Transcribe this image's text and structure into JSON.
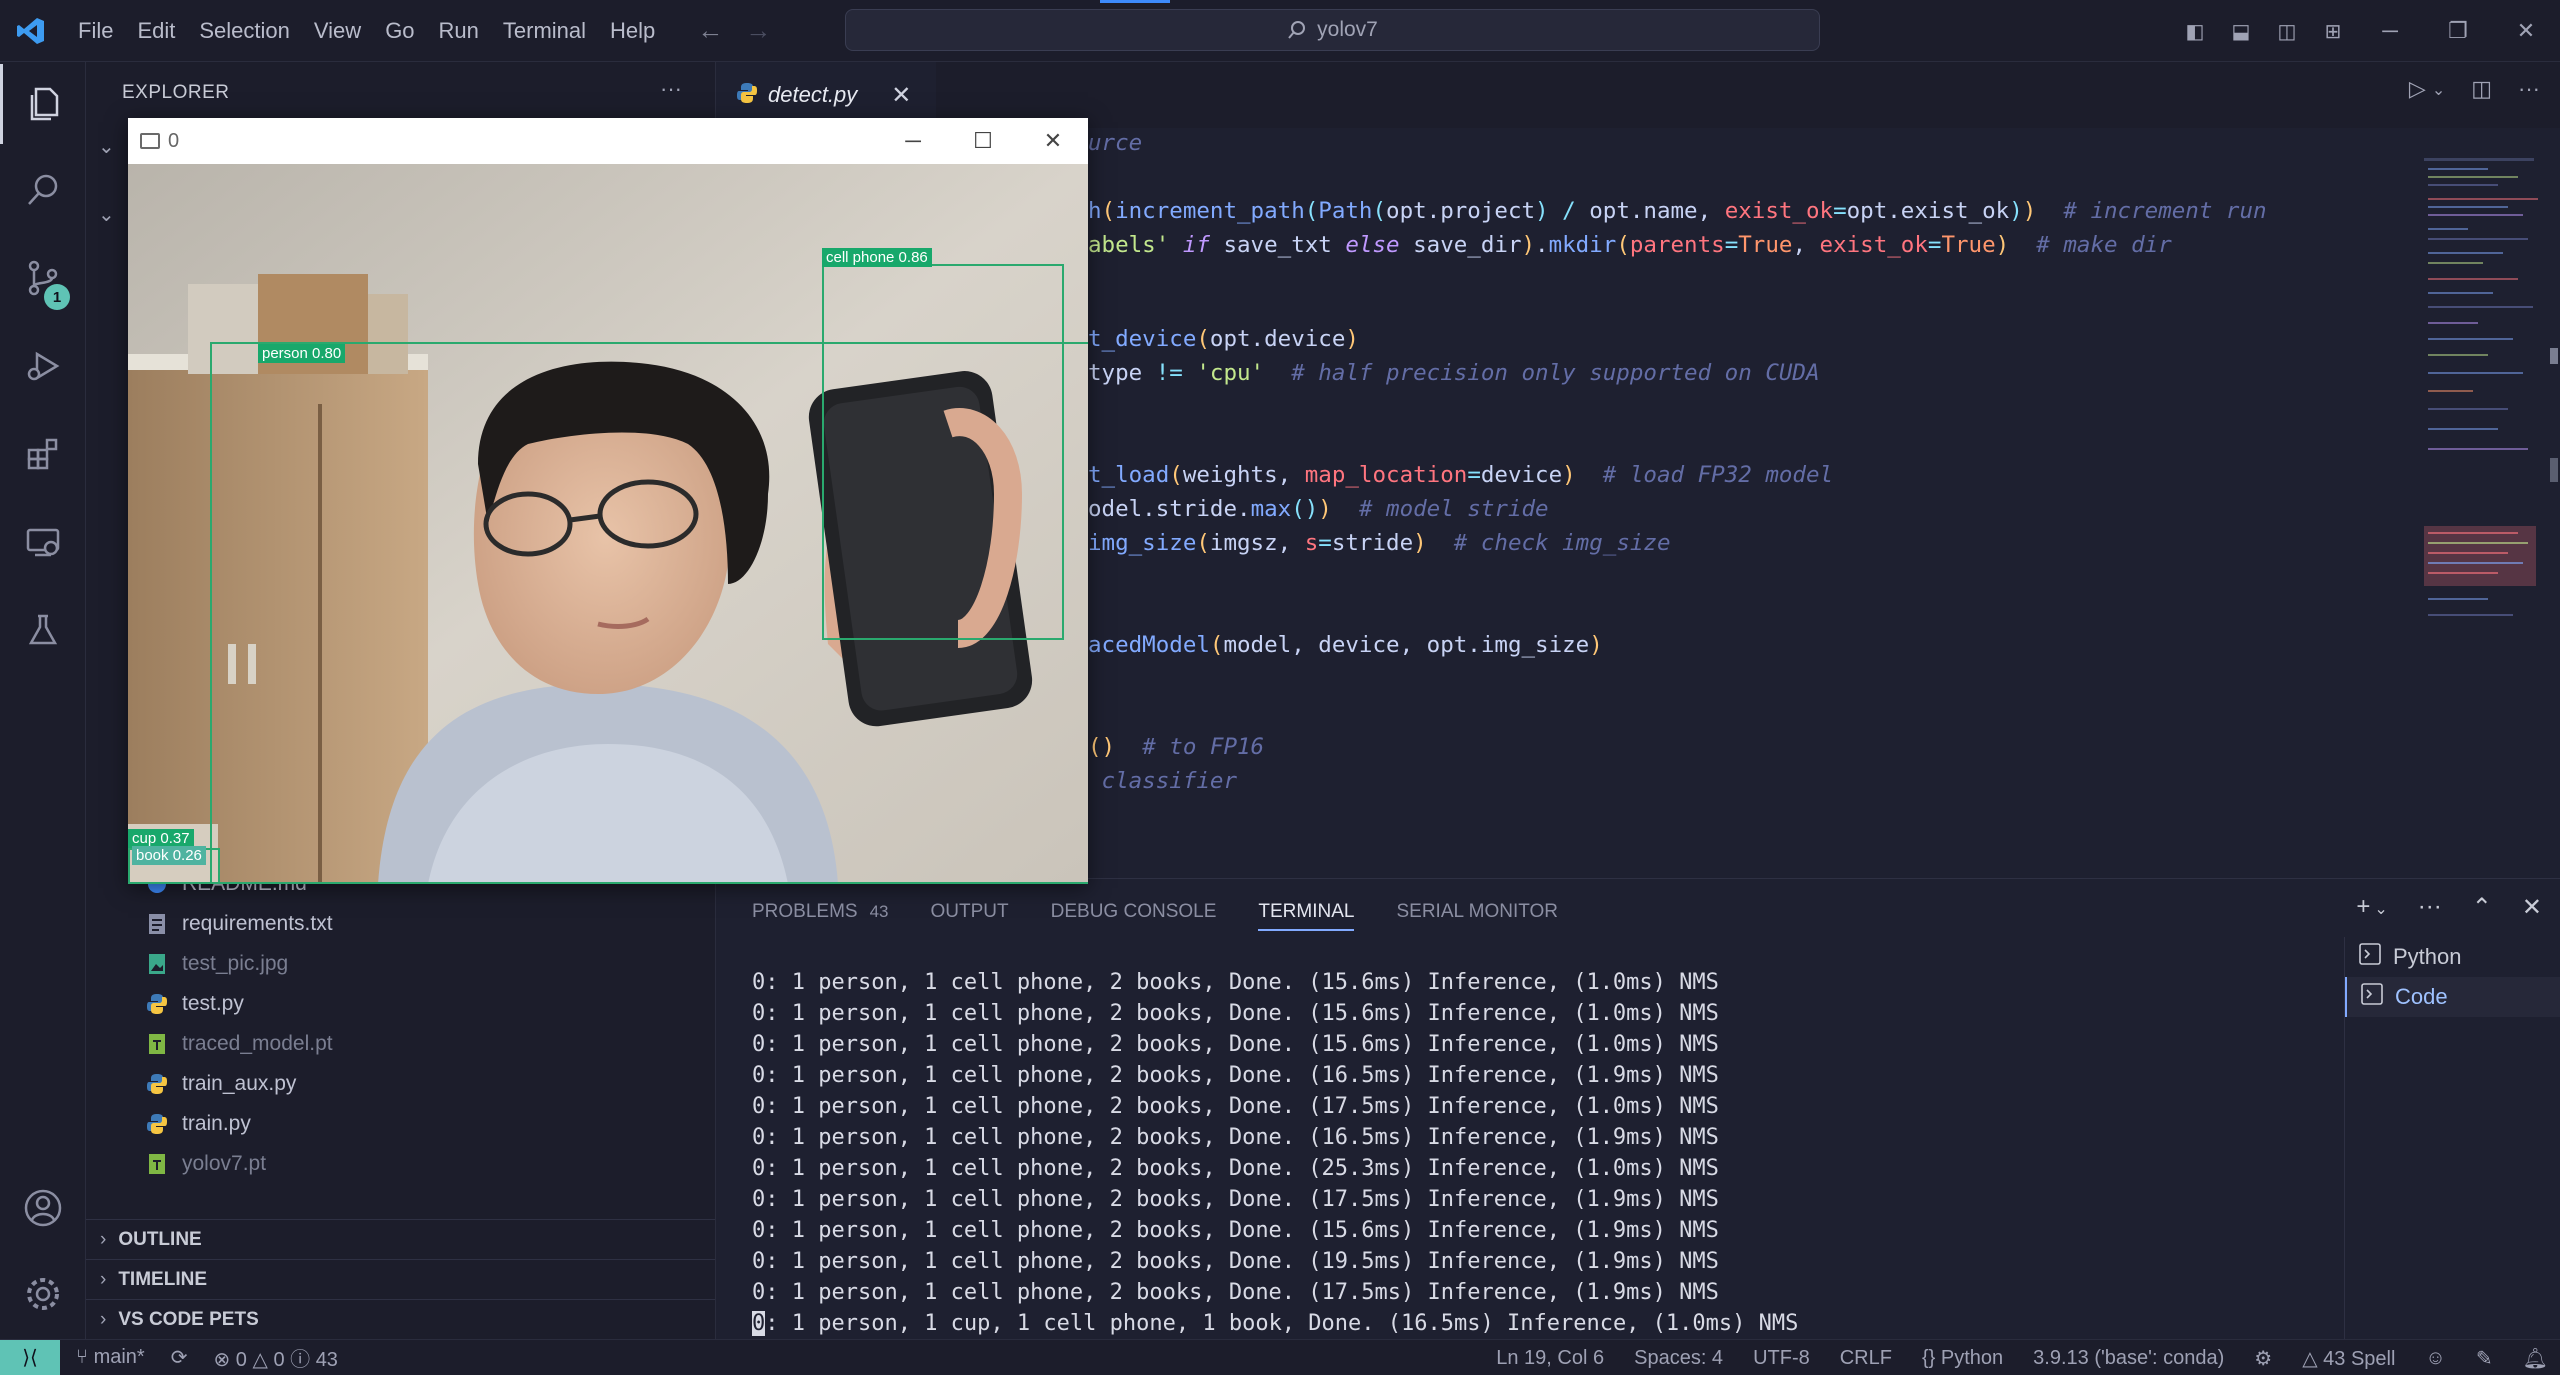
{
  "titlebar": {
    "menu": [
      "File",
      "Edit",
      "Selection",
      "View",
      "Go",
      "Run",
      "Terminal",
      "Help"
    ],
    "search": "yolov7"
  },
  "activity": {
    "scm_badge": "1"
  },
  "sidebar": {
    "title": "EXPLORER",
    "files": [
      {
        "name": "README.md",
        "icon": "info-icon",
        "dim": false
      },
      {
        "name": "requirements.txt",
        "icon": "text-file-icon",
        "dim": false
      },
      {
        "name": "test_pic.jpg",
        "icon": "image-icon",
        "dim": true
      },
      {
        "name": "test.py",
        "icon": "python-icon",
        "dim": false
      },
      {
        "name": "traced_model.pt",
        "icon": "model-file-icon",
        "dim": true
      },
      {
        "name": "train_aux.py",
        "icon": "python-icon",
        "dim": false
      },
      {
        "name": "train.py",
        "icon": "python-icon",
        "dim": false
      },
      {
        "name": "yolov7.pt",
        "icon": "model-file-icon",
        "dim": true
      }
    ],
    "sections": [
      "OUTLINE",
      "TIMELINE",
      "VS CODE PETS"
    ]
  },
  "editor": {
    "tab": "detect.py",
    "lines": [
      "urce",
      "h(increment_path(Path(opt.project) / opt.name, exist_ok=opt.exist_ok))  # increment run",
      "abels' if save_txt else save_dir).mkdir(parents=True, exist_ok=True)  # make dir",
      "t_device(opt.device)",
      "type != 'cpu'  # half precision only supported on CUDA",
      "t_load(weights, map_location=device)  # load FP32 model",
      "odel.stride.max())  # model stride",
      "img_size(imgsz, s=stride)  # check img_size",
      "acedModel(model, device, opt.img_size)",
      "()  # to FP16",
      " classifier"
    ]
  },
  "panel": {
    "tabs": [
      "PROBLEMS",
      "OUTPUT",
      "DEBUG CONSOLE",
      "TERMINAL",
      "SERIAL MONITOR"
    ],
    "problems_count": "43",
    "active_tab": "TERMINAL",
    "terminal_lines": [
      "0: 1 person, 1 cell phone, 2 books, Done. (15.6ms) Inference, (1.0ms) NMS",
      "0: 1 person, 1 cell phone, 2 books, Done. (15.6ms) Inference, (1.0ms) NMS",
      "0: 1 person, 1 cell phone, 2 books, Done. (15.6ms) Inference, (1.0ms) NMS",
      "0: 1 person, 1 cell phone, 2 books, Done. (16.5ms) Inference, (1.9ms) NMS",
      "0: 1 person, 1 cell phone, 2 books, Done. (17.5ms) Inference, (1.0ms) NMS",
      "0: 1 person, 1 cell phone, 2 books, Done. (16.5ms) Inference, (1.9ms) NMS",
      "0: 1 person, 1 cell phone, 2 books, Done. (25.3ms) Inference, (1.0ms) NMS",
      "0: 1 person, 1 cell phone, 2 books, Done. (17.5ms) Inference, (1.9ms) NMS",
      "0: 1 person, 1 cell phone, 2 books, Done. (15.6ms) Inference, (1.9ms) NMS",
      "0: 1 person, 1 cell phone, 2 books, Done. (19.5ms) Inference, (1.9ms) NMS",
      "0: 1 person, 1 cell phone, 2 books, Done. (17.5ms) Inference, (1.9ms) NMS"
    ],
    "last_line_cursor": "0",
    "last_line_rest": ": 1 person, 1 cup, 1 cell phone, 1 book, Done. (16.5ms) Inference, (1.0ms) NMS",
    "terminals": [
      "Python",
      "Code"
    ]
  },
  "statusbar": {
    "branch": "main*",
    "errors": "0",
    "warnings": "0",
    "infos": "43",
    "position": "Ln 19, Col 6",
    "spaces": "Spaces: 4",
    "encoding": "UTF-8",
    "eol": "CRLF",
    "language": "Python",
    "interpreter": "3.9.13 ('base': conda)",
    "spell": "43 Spell"
  },
  "camera_window": {
    "title": "0",
    "detections": [
      {
        "label": "person 0.80"
      },
      {
        "label": "cell phone 0.86"
      },
      {
        "label": "cup 0.37"
      },
      {
        "label": "book 0.26"
      }
    ]
  },
  "colors": {
    "accent": "#82aaff",
    "remote": "#5fc3b5",
    "detection": "#18a86b"
  }
}
